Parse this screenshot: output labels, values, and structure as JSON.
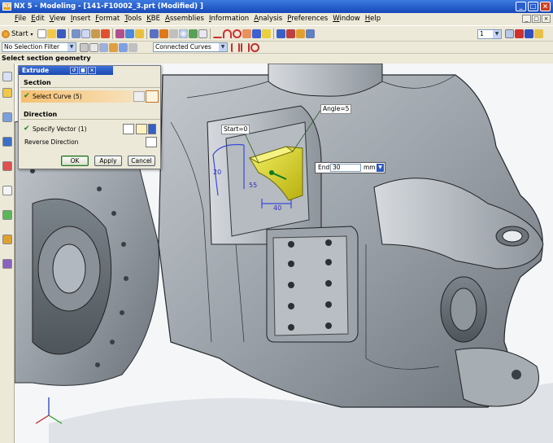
{
  "window": {
    "title": "NX 5 - Modeling - [141-F10002_3.prt (Modified) ]",
    "buttons": [
      "_",
      "□",
      "×"
    ],
    "doc_buttons": [
      "_",
      "□",
      "×"
    ]
  },
  "menu": [
    "File",
    "Edit",
    "View",
    "Insert",
    "Format",
    "Tools",
    "KBE",
    "Assemblies",
    "Information",
    "Analysis",
    "Preferences",
    "Window",
    "Help"
  ],
  "toolbar": {
    "start_label": "Start",
    "layer_value": "1",
    "selection_filter": "No Selection Filter",
    "curve_rule": "Connected Curves",
    "dropdown_glyph": "▼"
  },
  "status": {
    "prompt": "Select section geometry"
  },
  "dialog": {
    "title": "Extrude",
    "title_buttons": [
      "↺",
      "■",
      "×"
    ],
    "section_header": "Section",
    "select_curve": "Select Curve (5)",
    "direction_header": "Direction",
    "specify_vector": "Specify Vector (1)",
    "reverse_direction": "Reverse Direction",
    "ok": "OK",
    "apply": "Apply",
    "cancel": "Cancel",
    "check_glyph": "✔"
  },
  "callouts": {
    "angle": "Angle=5",
    "start": "Start=0",
    "end_label": "End",
    "end_value": "30",
    "end_unit": "mm"
  },
  "dimensions": {
    "d1": "40",
    "d2": "55",
    "d3": "20"
  },
  "colors": {
    "title_bar": "#2457c5",
    "chrome": "#ece9d8",
    "section_highlight": "#f5c070",
    "model_gray": "#9aa1a8",
    "extrude_yellow": "#e6e020",
    "sketch_blue": "#3a4ad8"
  }
}
